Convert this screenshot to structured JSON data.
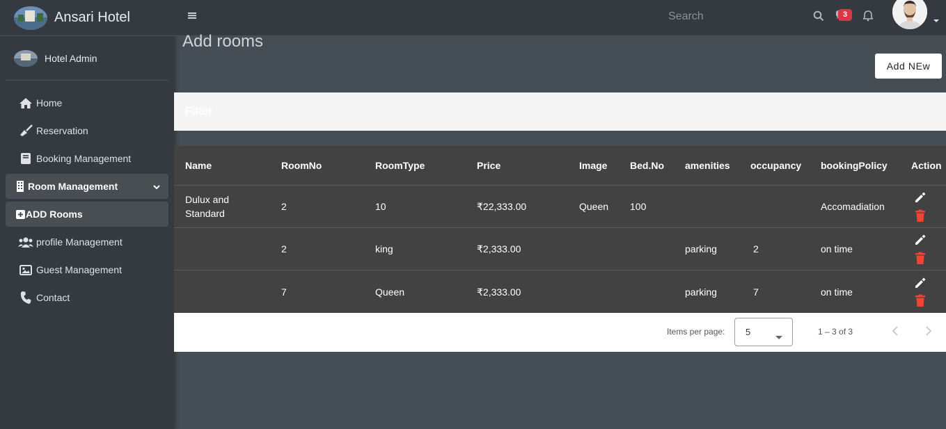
{
  "brand": {
    "name": "Ansari Hotel"
  },
  "user": {
    "name": "Hotel Admin"
  },
  "sidebar": {
    "items": [
      {
        "label": "Home",
        "icon": "home-icon"
      },
      {
        "label": "Reservation",
        "icon": "broom-icon"
      },
      {
        "label": "Booking Management",
        "icon": "book-icon"
      },
      {
        "label": "Room Management",
        "icon": "building-icon"
      },
      {
        "label": "ADD Rooms",
        "icon": "plus-square-icon"
      },
      {
        "label": "profile Management",
        "icon": "users-icon"
      },
      {
        "label": "Guest Management",
        "icon": "image-icon"
      },
      {
        "label": "Contact",
        "icon": "phone-icon"
      }
    ]
  },
  "topbar": {
    "search_placeholder": "Search",
    "messages_count": "3"
  },
  "page": {
    "title": "Add rooms",
    "add_button": "Add NEw",
    "filter_title": "Filter"
  },
  "table": {
    "headers": [
      "Name",
      "RoomNo",
      "RoomType",
      "Price",
      "Image",
      "Bed.No",
      "amenities",
      "occupancy",
      "bookingPolicy",
      "Action"
    ],
    "rows": [
      [
        "Dulux and Standard",
        "2",
        "10",
        "₹22,333.00",
        "Queen",
        "100",
        "",
        "",
        "Accomadiation"
      ],
      [
        "",
        "2",
        "king",
        "₹2,333.00",
        "",
        "",
        "parking",
        "2",
        "on time"
      ],
      [
        "",
        "7",
        "Queen",
        "₹2,333.00",
        "",
        "",
        "parking",
        "7",
        "on time"
      ]
    ]
  },
  "paginator": {
    "items_per_page_label": "Items per page:",
    "items_per_page_value": "5",
    "range_label": "1 – 3 of 3"
  },
  "colors": {
    "sidebar_bg": "#343a40",
    "content_bg": "#454d55",
    "table_bg": "#424242",
    "badge_red": "#dc3545",
    "delete_red": "#f44336"
  }
}
